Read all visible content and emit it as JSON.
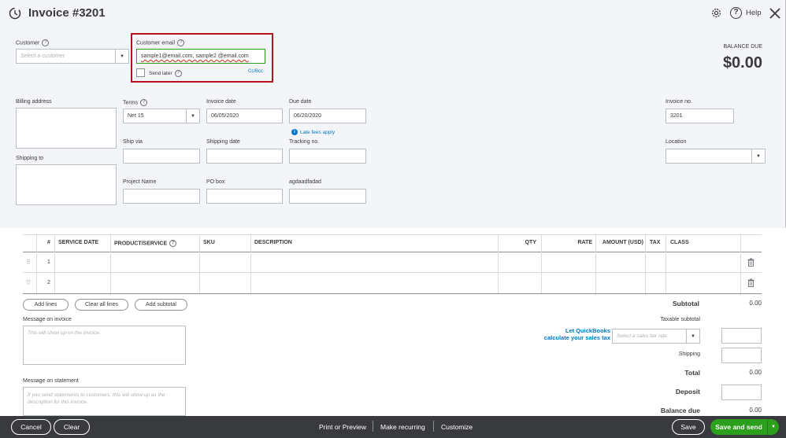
{
  "header": {
    "title": "Invoice #3201",
    "help_label": "Help",
    "icons": {
      "logo": "recent-transactions-icon",
      "settings": "gear-icon",
      "help": "help-icon",
      "close": "close-icon"
    }
  },
  "customer": {
    "label": "Customer",
    "placeholder": "Select a customer"
  },
  "customer_email": {
    "label": "Customer email",
    "value": "sample1@email.com, sample2 @email.com",
    "send_later_label": "Send later",
    "cc_bcc": "Cc/Bcc"
  },
  "balance": {
    "label": "BALANCE DUE",
    "amount": "$0.00"
  },
  "fields": {
    "billing_address": "Billing address",
    "shipping_to": "Shipping to",
    "terms": {
      "label": "Terms",
      "value": "Net 15"
    },
    "invoice_date": {
      "label": "Invoice date",
      "value": "06/05/2020"
    },
    "due_date": {
      "label": "Due date",
      "value": "06/20/2020"
    },
    "late_fees": "Late fees apply",
    "invoice_no": {
      "label": "Invoice no.",
      "value": "3201"
    },
    "ship_via": "Ship via",
    "shipping_date": "Shipping date",
    "tracking_no": "Tracking no.",
    "location": "Location",
    "project_name": "Project Name",
    "po_box": "PO box",
    "custom": "agdaadfadad"
  },
  "table": {
    "columns": [
      "#",
      "SERVICE DATE",
      "PRODUCT/SERVICE",
      "SKU",
      "DESCRIPTION",
      "QTY",
      "RATE",
      "AMOUNT (USD)",
      "TAX",
      "CLASS"
    ],
    "rows": [
      {
        "num": "1"
      },
      {
        "num": "2"
      }
    ]
  },
  "line_buttons": {
    "add_lines": "Add lines",
    "clear_all": "Clear all lines",
    "add_subtotal": "Add subtotal"
  },
  "message_invoice": {
    "label": "Message on invoice",
    "placeholder": "This will show up on the invoice."
  },
  "message_statement": {
    "label": "Message on statement",
    "placeholder": "If you send statements to customers, this will show up as the description for this invoice."
  },
  "totals": {
    "subtotal_label": "Subtotal",
    "subtotal": "0.00",
    "taxable_label": "Taxable subtotal",
    "tax_link_1": "Let QuickBooks",
    "tax_link_2": "calculate your sales tax",
    "tax_rate_placeholder": "Select a sales tax rate",
    "shipping_label": "Shipping",
    "total_label": "Total",
    "total": "0.00",
    "deposit_label": "Deposit",
    "balance_due_label": "Balance due",
    "balance_due": "0.00"
  },
  "footer": {
    "cancel": "Cancel",
    "clear": "Clear",
    "print": "Print or Preview",
    "recurring": "Make recurring",
    "customize": "Customize",
    "save": "Save",
    "save_send": "Save and send"
  },
  "colors": {
    "green": "#2ca01c",
    "link": "#0077c5",
    "highlight": "#b3121c",
    "footer": "#393a3d"
  }
}
